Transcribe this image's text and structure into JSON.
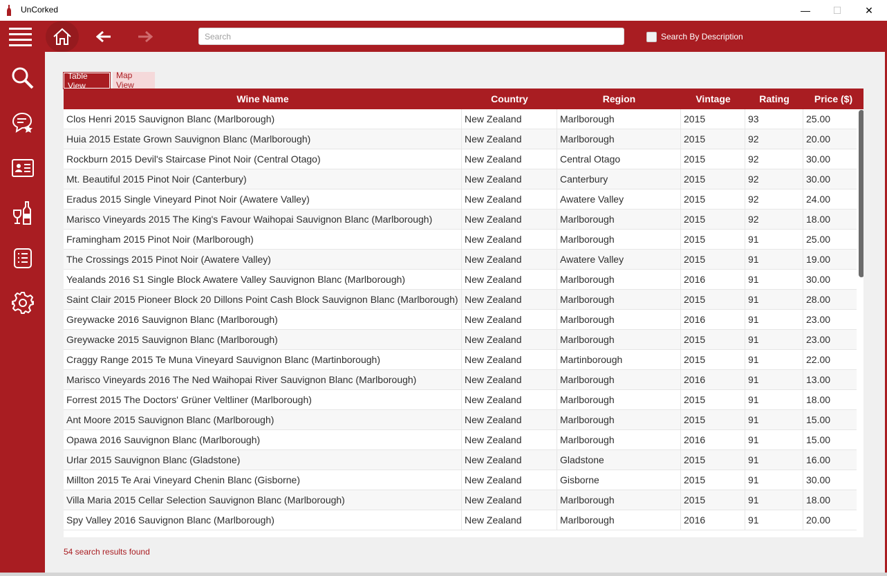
{
  "window": {
    "title": "UnCorked",
    "minimize": "—",
    "maximize": "☐",
    "close": "✕"
  },
  "toolbar": {
    "search_placeholder": "Search",
    "search_value": "",
    "search_by_description_label": "Search By Description",
    "search_by_description_checked": false
  },
  "sidebar": {
    "items": [
      {
        "icon": "search-icon"
      },
      {
        "icon": "chat-star-icon"
      },
      {
        "icon": "profile-card-icon"
      },
      {
        "icon": "wine-glass-bottle-icon"
      },
      {
        "icon": "list-document-icon"
      },
      {
        "icon": "gear-icon"
      }
    ]
  },
  "tabs": [
    {
      "label": "Table View",
      "active": true
    },
    {
      "label": "Map View",
      "active": false
    }
  ],
  "table": {
    "columns": [
      "Wine Name",
      "Country",
      "Region",
      "Vintage",
      "Rating",
      "Price ($)"
    ],
    "rows": [
      [
        "Clos Henri 2015 Sauvignon Blanc (Marlborough)",
        "New Zealand",
        "Marlborough",
        "2015",
        "93",
        "25.00"
      ],
      [
        "Huia 2015 Estate Grown Sauvignon Blanc (Marlborough)",
        "New Zealand",
        "Marlborough",
        "2015",
        "92",
        "20.00"
      ],
      [
        "Rockburn 2015 Devil's Staircase Pinot Noir (Central Otago)",
        "New Zealand",
        "Central Otago",
        "2015",
        "92",
        "30.00"
      ],
      [
        "Mt. Beautiful 2015 Pinot Noir (Canterbury)",
        "New Zealand",
        "Canterbury",
        "2015",
        "92",
        "30.00"
      ],
      [
        "Eradus 2015 Single Vineyard Pinot Noir (Awatere Valley)",
        "New Zealand",
        "Awatere Valley",
        "2015",
        "92",
        "24.00"
      ],
      [
        "Marisco Vineyards 2015 The King's Favour Waihopai Sauvignon Blanc (Marlborough)",
        "New Zealand",
        "Marlborough",
        "2015",
        "92",
        "18.00"
      ],
      [
        "Framingham 2015 Pinot Noir (Marlborough)",
        "New Zealand",
        "Marlborough",
        "2015",
        "91",
        "25.00"
      ],
      [
        "The Crossings 2015 Pinot Noir (Awatere Valley)",
        "New Zealand",
        "Awatere Valley",
        "2015",
        "91",
        "19.00"
      ],
      [
        "Yealands 2016 S1 Single Block Awatere Valley Sauvignon Blanc (Marlborough)",
        "New Zealand",
        "Marlborough",
        "2016",
        "91",
        "30.00"
      ],
      [
        "Saint Clair 2015 Pioneer Block 20 Dillons Point Cash Block Sauvignon Blanc (Marlborough)",
        "New Zealand",
        "Marlborough",
        "2015",
        "91",
        "28.00"
      ],
      [
        "Greywacke 2016 Sauvignon Blanc (Marlborough)",
        "New Zealand",
        "Marlborough",
        "2016",
        "91",
        "23.00"
      ],
      [
        "Greywacke 2015 Sauvignon Blanc (Marlborough)",
        "New Zealand",
        "Marlborough",
        "2015",
        "91",
        "23.00"
      ],
      [
        "Craggy Range 2015 Te Muna Vineyard Sauvignon Blanc (Martinborough)",
        "New Zealand",
        "Martinborough",
        "2015",
        "91",
        "22.00"
      ],
      [
        "Marisco Vineyards 2016 The Ned Waihopai River Sauvignon Blanc (Marlborough)",
        "New Zealand",
        "Marlborough",
        "2016",
        "91",
        "13.00"
      ],
      [
        "Forrest 2015 The Doctors' Grüner Veltliner (Marlborough)",
        "New Zealand",
        "Marlborough",
        "2015",
        "91",
        "18.00"
      ],
      [
        "Ant Moore 2015 Sauvignon Blanc (Marlborough)",
        "New Zealand",
        "Marlborough",
        "2015",
        "91",
        "15.00"
      ],
      [
        "Opawa 2016 Sauvignon Blanc (Marlborough)",
        "New Zealand",
        "Marlborough",
        "2016",
        "91",
        "15.00"
      ],
      [
        "Urlar 2015 Sauvignon Blanc (Gladstone)",
        "New Zealand",
        "Gladstone",
        "2015",
        "91",
        "16.00"
      ],
      [
        "Millton 2015 Te Arai Vineyard Chenin Blanc (Gisborne)",
        "New Zealand",
        "Gisborne",
        "2015",
        "91",
        "30.00"
      ],
      [
        "Villa Maria 2015 Cellar Selection Sauvignon Blanc (Marlborough)",
        "New Zealand",
        "Marlborough",
        "2015",
        "91",
        "18.00"
      ],
      [
        "Spy Valley 2016 Sauvignon Blanc (Marlborough)",
        "New Zealand",
        "Marlborough",
        "2016",
        "91",
        "20.00"
      ]
    ]
  },
  "status": {
    "results_text": "54 search results found"
  },
  "colors": {
    "accent": "#a91d22",
    "accent_light": "#f5d9da",
    "text": "#2e2e2e"
  }
}
